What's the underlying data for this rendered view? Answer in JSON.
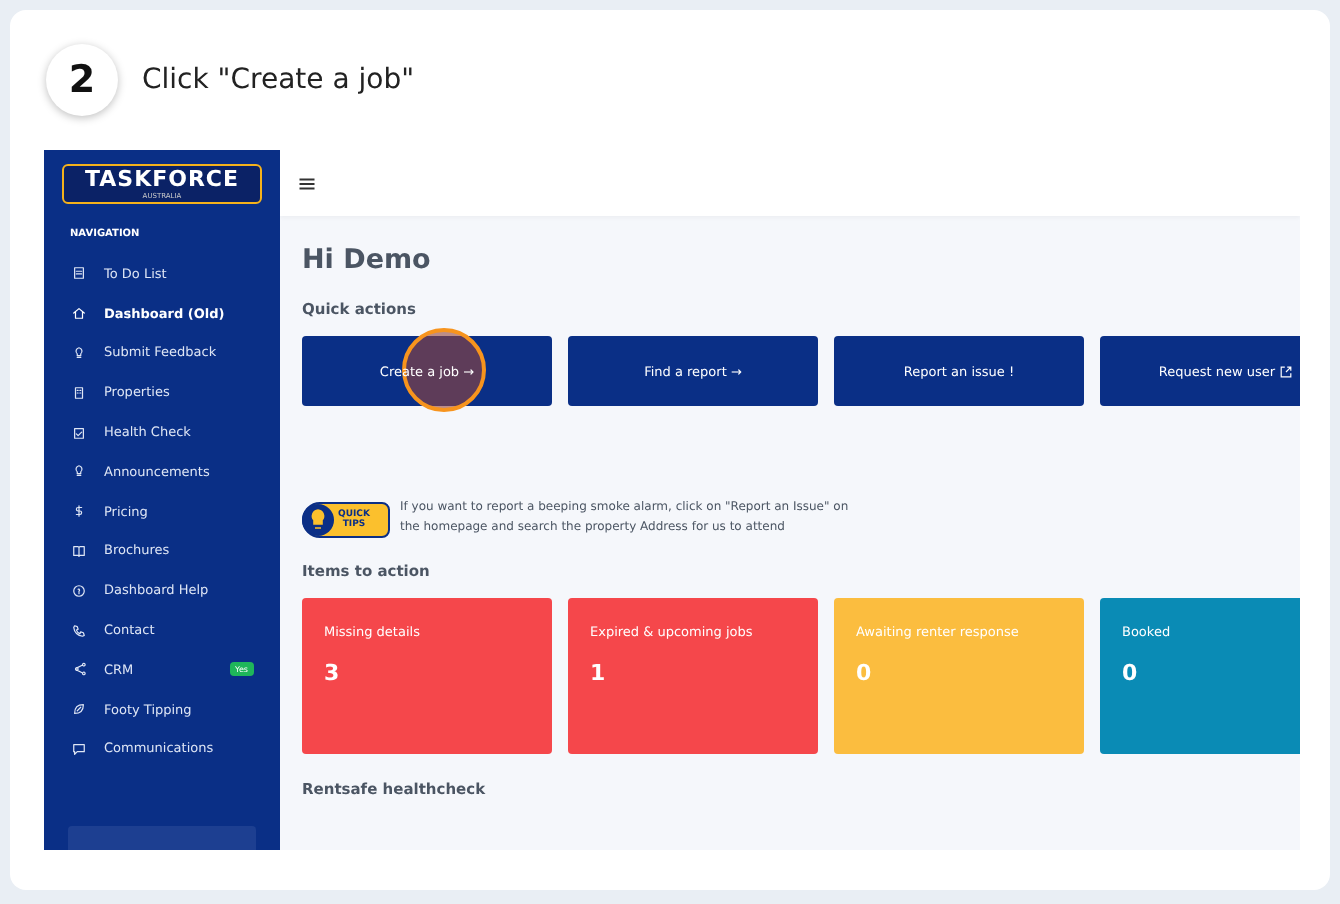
{
  "step": {
    "number": "2",
    "instruction": "Click \"Create a job\""
  },
  "sidebar": {
    "logo": "TASKFORCE",
    "logo_sub": "AUSTRALIA",
    "section": "NAVIGATION",
    "items": [
      {
        "label": "To Do List",
        "selected": false
      },
      {
        "label": "Dashboard (Old)",
        "selected": true
      },
      {
        "label": "Submit Feedback",
        "selected": false
      },
      {
        "label": "Properties",
        "selected": false
      },
      {
        "label": "Health Check",
        "selected": false
      },
      {
        "label": "Announcements",
        "selected": false
      },
      {
        "label": "Pricing",
        "selected": false
      },
      {
        "label": "Brochures",
        "selected": false
      },
      {
        "label": "Dashboard Help",
        "selected": false
      },
      {
        "label": "Contact",
        "selected": false
      },
      {
        "label": "CRM",
        "selected": false,
        "badge": "Yes"
      },
      {
        "label": "Footy Tipping",
        "selected": false
      },
      {
        "label": "Communications",
        "selected": false
      }
    ]
  },
  "greeting": "Hi Demo",
  "quick_actions": {
    "title": "Quick actions",
    "buttons": [
      {
        "label": "Create a job →",
        "highlighted": true,
        "external": false
      },
      {
        "label": "Find a report →",
        "highlighted": false,
        "external": false
      },
      {
        "label": "Report an issue !",
        "highlighted": false,
        "external": false
      },
      {
        "label": "Request new user",
        "highlighted": false,
        "external": true
      }
    ]
  },
  "tip": {
    "badge": "QUICK TIPS",
    "text": "If you want to report a beeping smoke alarm, click on \"Report an Issue\" on the homepage and search the property Address for us to attend"
  },
  "items_to_action": {
    "title": "Items to action",
    "cards": [
      {
        "label": "Missing details",
        "count": "3",
        "color": "#f5474b"
      },
      {
        "label": "Expired & upcoming jobs",
        "count": "1",
        "color": "#f5474b"
      },
      {
        "label": "Awaiting renter response",
        "count": "0",
        "color": "#fbbd3f"
      },
      {
        "label": "Booked",
        "count": "0",
        "color": "#0a8bb5"
      }
    ]
  },
  "next_section": "Rentsafe healthcheck"
}
